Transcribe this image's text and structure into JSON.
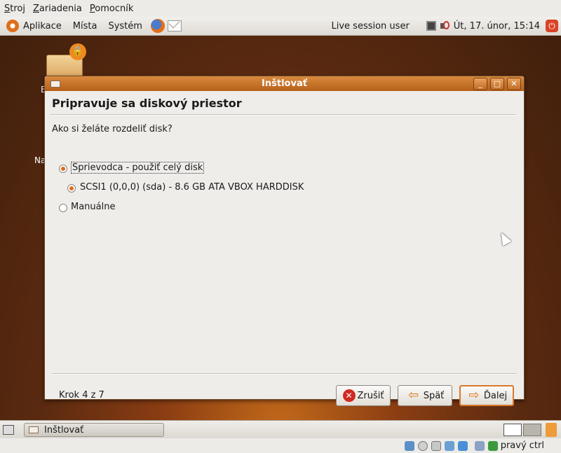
{
  "host_menu": [
    "Stroj",
    "Zariadenia",
    "Pomocník"
  ],
  "panel": {
    "menus": [
      "Aplikace",
      "Místa",
      "Systém"
    ],
    "session_user": "Live session user",
    "clock": "Út, 17. únor, 15:14"
  },
  "desktop": {
    "icon_label_1": "E",
    "icon_label_2": "Na"
  },
  "dialog": {
    "title": "Inštlovať",
    "heading": "Pripravuje sa diskový priestor",
    "question": "Ako si želáte rozdeliť disk?",
    "options": [
      {
        "label": "Sprievodca - použiť celý disk",
        "selected": true
      },
      {
        "label": "SCSI1 (0,0,0) (sda) - 8.6 GB ATA VBOX HARDDISK",
        "selected": true
      },
      {
        "label": "Manuálne",
        "selected": false
      }
    ],
    "step": "Krok 4 z 7",
    "buttons": {
      "cancel": "Zrušiť",
      "back": "Späť",
      "next": "Ďalej"
    }
  },
  "taskbar": {
    "task_label": "Inštlovať"
  },
  "vbox_status": {
    "hostkey": "pravý ctrl"
  }
}
